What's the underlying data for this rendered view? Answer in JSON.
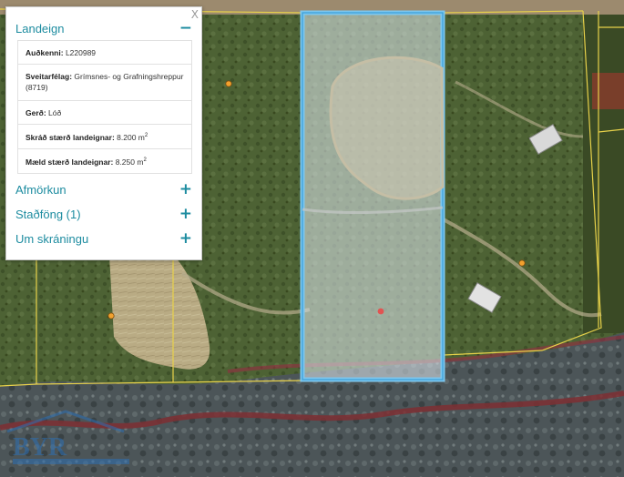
{
  "panel": {
    "close_label": "X",
    "main_section": {
      "title": "Landeign",
      "toggle": "−",
      "rows": [
        {
          "label": "Auðkenni:",
          "value": "L220989"
        },
        {
          "label": "Sveitarfélag:",
          "value": "Grímsnes- og Grafningshreppur (8719)"
        },
        {
          "label": "Gerð:",
          "value": "Lóð"
        },
        {
          "label": "Skráð stærð landeignar:",
          "value": "8.200 m",
          "sup": "2"
        },
        {
          "label": "Mæld stærð landeignar:",
          "value": "8.250 m",
          "sup": "2"
        }
      ]
    },
    "collapsed_sections": [
      {
        "title": "Afmörkun",
        "toggle": "+"
      },
      {
        "title": "Staðföng (1)",
        "toggle": "+"
      },
      {
        "title": "Um skráningu",
        "toggle": "+"
      }
    ]
  },
  "watermark": {
    "brand": "BYR"
  },
  "colors": {
    "accent": "#1d8ca0",
    "parcel_border": "#e8d24a",
    "selected_parcel": "#5ab4e6",
    "marker_orange": "#f2a12e",
    "marker_red": "#e84a4a"
  }
}
